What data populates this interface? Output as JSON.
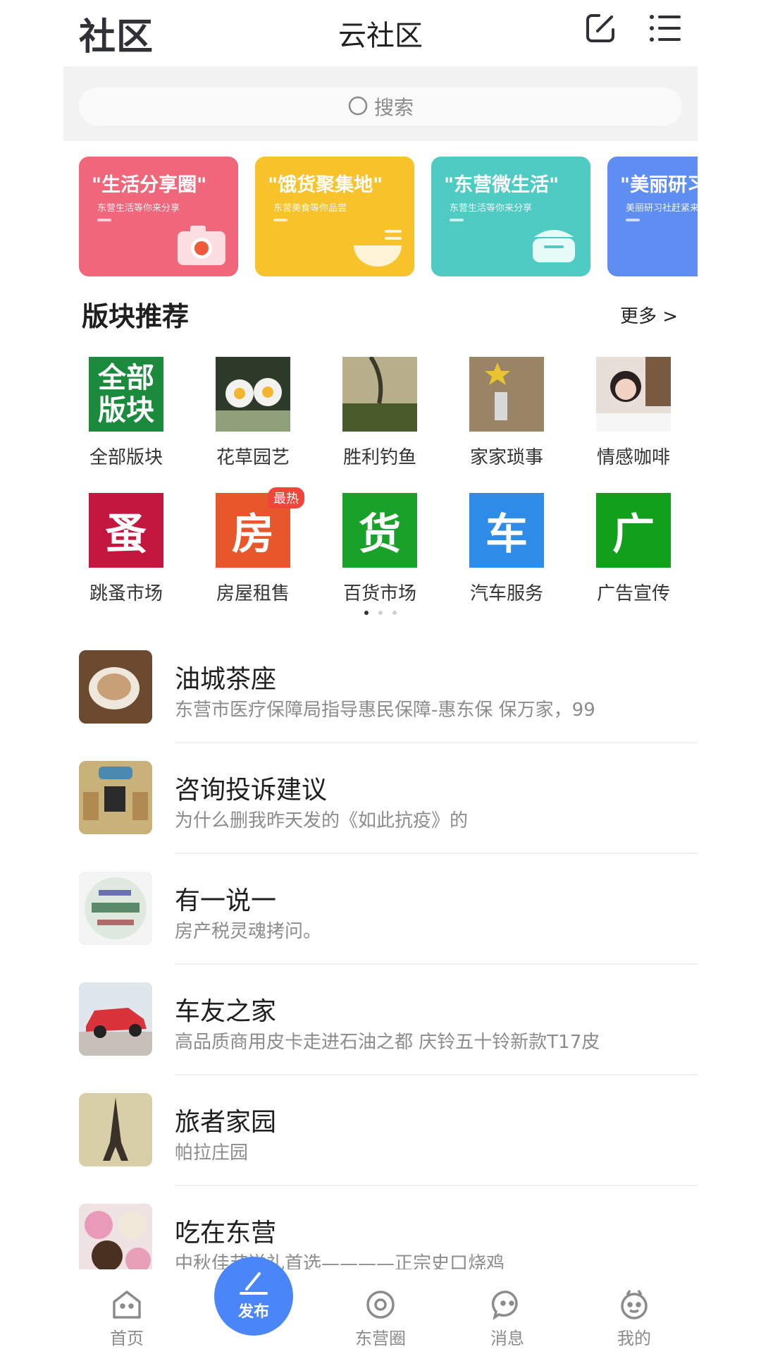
{
  "header": {
    "logo": "社区",
    "title": "云社区"
  },
  "search": {
    "placeholder": "搜索"
  },
  "banners": [
    {
      "title": "\"生活分享圈\"",
      "subtitle": "东营生活等你来分享",
      "color": "#f0667a",
      "icon": "camera-icon"
    },
    {
      "title": "\"饿货聚集地\"",
      "subtitle": "东营美食等你品尝",
      "color": "#f7c22a",
      "icon": "noodle-bowl-icon"
    },
    {
      "title": "\"东营微生活\"",
      "subtitle": "东营生活等你来分享",
      "color": "#4fcbc3",
      "icon": "rice-cooker-icon"
    },
    {
      "title": "\"美丽研习",
      "subtitle": "美丽研习社赶紧来",
      "color": "#5f8ef2",
      "icon": "none"
    }
  ],
  "section": {
    "title": "版块推荐",
    "more": "更多 >"
  },
  "boards": [
    {
      "label": "全部版块",
      "thumb_text": "全部\n版块",
      "color": "#1a8a3c"
    },
    {
      "label": "花草园艺",
      "thumb_text": "",
      "color": "#6b7d4a"
    },
    {
      "label": "胜利钓鱼",
      "thumb_text": "",
      "color": "#7a7350"
    },
    {
      "label": "家家琐事",
      "thumb_text": "",
      "color": "#8a7258"
    },
    {
      "label": "情感咖啡",
      "thumb_text": "",
      "color": "#c9b7a8"
    },
    {
      "label": "跳蚤市场",
      "thumb_text": "蚤",
      "color": "#c4173f"
    },
    {
      "label": "房屋租售",
      "thumb_text": "房",
      "color": "#e8562b",
      "badge": "最热"
    },
    {
      "label": "百货市场",
      "thumb_text": "货",
      "color": "#1aa12a"
    },
    {
      "label": "汽车服务",
      "thumb_text": "车",
      "color": "#2f8be8"
    },
    {
      "label": "广告宣传",
      "thumb_text": "广",
      "color": "#119f1c"
    }
  ],
  "page_dots": {
    "count": 3,
    "active": 1
  },
  "forums": [
    {
      "name": "油城茶座",
      "desc": "东营市医疗保障局指导惠民保障-惠东保 保万家，99",
      "color": "#8a6a4a"
    },
    {
      "name": "咨询投诉建议",
      "desc": "为什么删我昨天发的《如此抗疫》的",
      "color": "#c8a86a"
    },
    {
      "name": "有一说一",
      "desc": "房产税灵魂拷问。",
      "color": "#7aa08a"
    },
    {
      "name": "车友之家",
      "desc": "高品质商用皮卡走进石油之都 庆铃五十铃新款T17皮",
      "color": "#c0393b"
    },
    {
      "name": "旅者家园",
      "desc": "帕拉庄园",
      "color": "#c9b98a"
    },
    {
      "name": "吃在东营",
      "desc": "中秋佳节送礼首选————正宗史口烧鸡",
      "color": "#b0567a"
    }
  ],
  "tabbar": {
    "home": "首页",
    "publish": "发布",
    "circle": "东营圈",
    "messages": "消息",
    "mine": "我的"
  },
  "colors": {
    "accent": "#4a86f7",
    "hot_badge": "#f0463a"
  }
}
